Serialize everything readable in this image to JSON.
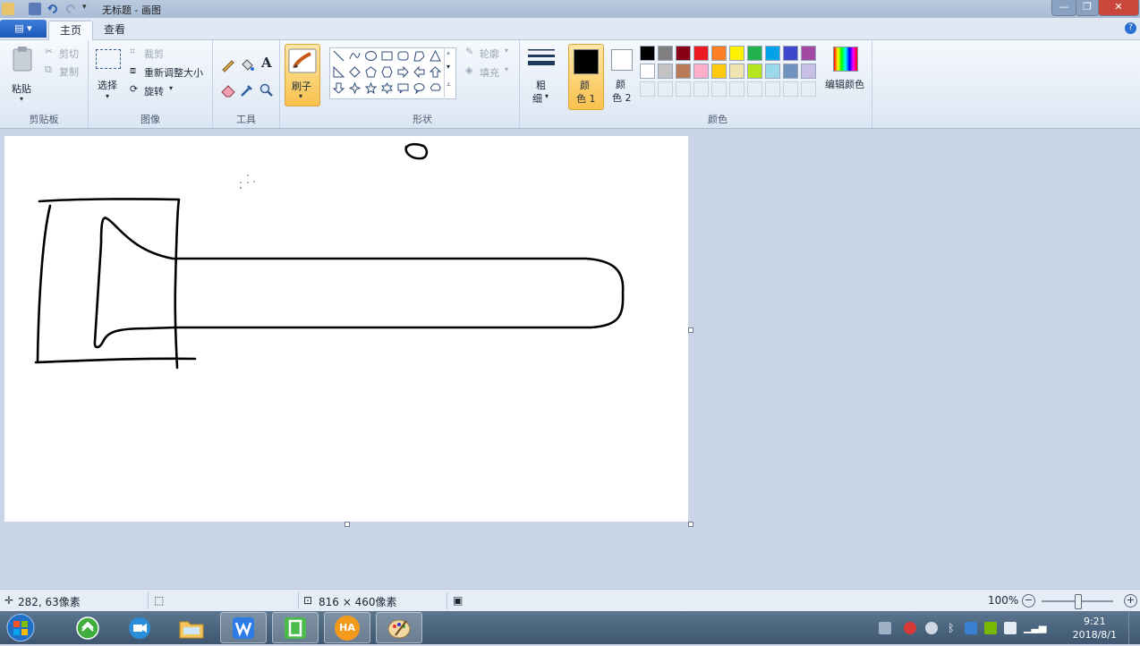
{
  "window": {
    "title": "无标题 - 画图"
  },
  "tabs": {
    "file": "▤ ▾",
    "home": "主页",
    "view": "查看",
    "help": "?"
  },
  "clipboard": {
    "paste": "粘贴",
    "cut": "剪切",
    "copy": "复制",
    "group": "剪贴板"
  },
  "image": {
    "select": "选择",
    "crop": "裁剪",
    "resize": "重新调整大小",
    "rotate": "旋转",
    "group": "图像"
  },
  "tools": {
    "text_tool": "A",
    "group": "工具"
  },
  "brushes": {
    "label": "刷子"
  },
  "shapes": {
    "outline": "轮廓",
    "fill": "填充",
    "group": "形状"
  },
  "size": {
    "label_line1": "粗",
    "label_line2": "细"
  },
  "colors": {
    "color1_line1": "颜",
    "color1_line2": "色 1",
    "color2_line1": "颜",
    "color2_line2": "色 2",
    "edit_colors": "编辑颜色",
    "group": "颜色",
    "color1_value": "#000000",
    "color2_value": "#ffffff",
    "palette_row1": [
      "#000000",
      "#7f7f7f",
      "#880015",
      "#ed1c24",
      "#ff7f27",
      "#fff200",
      "#22b14c",
      "#00a2e8",
      "#3f48cc",
      "#a349a4"
    ],
    "palette_row2": [
      "#ffffff",
      "#c3c3c3",
      "#b97a57",
      "#ffaec9",
      "#ffc90e",
      "#efe4b0",
      "#b5e61d",
      "#99d9ea",
      "#7092be",
      "#c8bfe7"
    ]
  },
  "status": {
    "cursor_pos": "282, 63像素",
    "canvas_size": "816 × 460像素",
    "zoom": "100%"
  },
  "taskbar": {
    "time": "9:21",
    "date": "2018/8/1",
    "ha_label": "HA"
  }
}
